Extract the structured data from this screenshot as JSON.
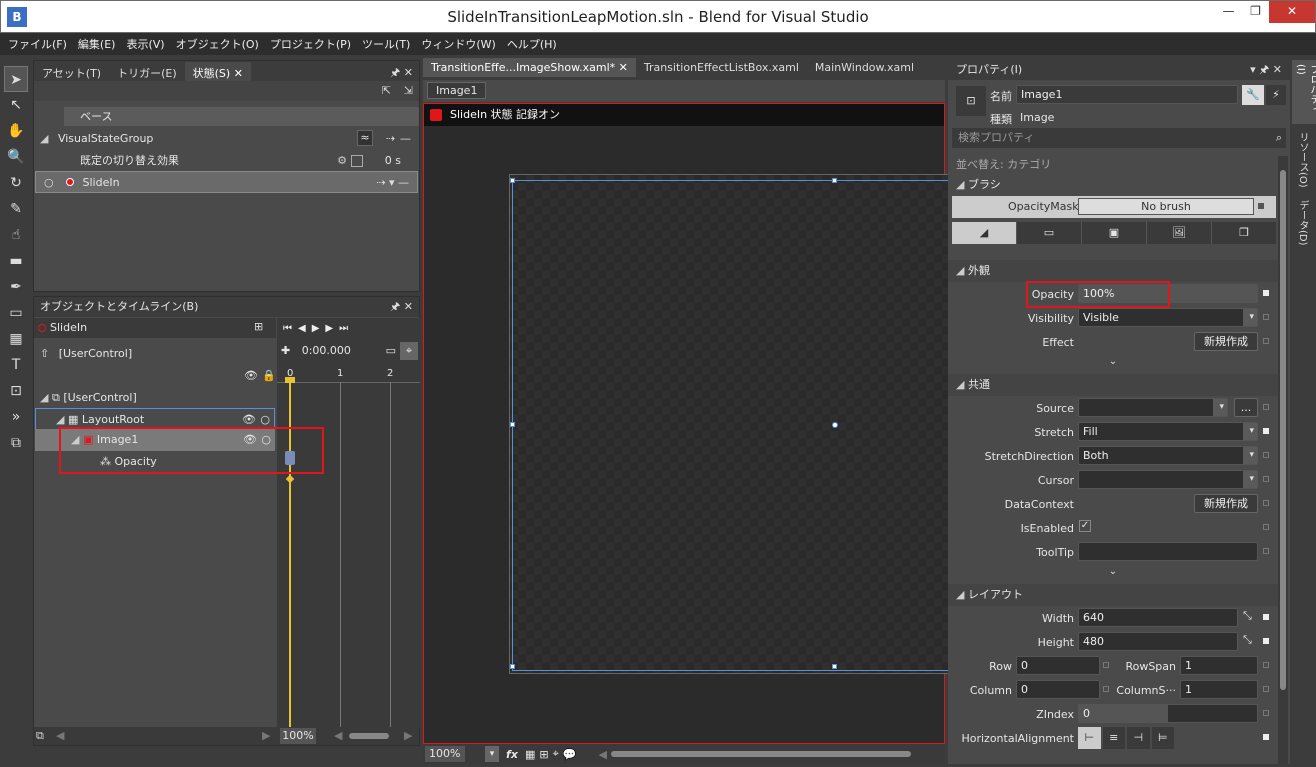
{
  "window": {
    "title": "SlideInTransitionLeapMotion.sln - Blend for Visual Studio",
    "app_icon": "B"
  },
  "menu": [
    "ファイル(F)",
    "編集(E)",
    "表示(V)",
    "オブジェクト(O)",
    "プロジェクト(P)",
    "ツール(T)",
    "ウィンドウ(W)",
    "ヘルプ(H)"
  ],
  "states_panel": {
    "tabs": [
      "アセット(T)",
      "トリガー(E)",
      "状態(S)"
    ],
    "base_label": "ベース",
    "group_name": "VisualStateGroup",
    "default_transition_label": "既定の切り替え効果",
    "default_transition_value": "0 s",
    "state_name": "SlideIn"
  },
  "timeline_panel": {
    "title": "オブジェクトとタイムライン(B)",
    "state_name": "SlideIn",
    "root_scope": "[UserControl]",
    "time": "0:00.000",
    "ruler": [
      "0",
      "1",
      "2"
    ],
    "tree": [
      {
        "name": "[UserControl]"
      },
      {
        "name": "LayoutRoot"
      },
      {
        "name": "Image1"
      },
      {
        "name": "Opacity"
      }
    ],
    "zoom": "100%"
  },
  "editor": {
    "tabs": [
      "TransitionEffe...ImageShow.xaml*",
      "TransitionEffectListBox.xaml",
      "MainWindow.xaml"
    ],
    "breadcrumb": "Image1",
    "recording_banner": "SlideIn 状態 記録オン",
    "zoom": "100%",
    "fx_label": "fx"
  },
  "properties": {
    "title": "プロパティ(I)",
    "name_label": "名前",
    "name_value": "Image1",
    "type_label": "種類",
    "type_value": "Image",
    "search_placeholder": "検索プロパティ",
    "sort_label": "並べ替え: カテゴリ",
    "side_tabs": [
      "プロパティ(I)",
      "リソース(O)",
      "データ(D)"
    ],
    "brush": {
      "header": "ブラシ",
      "mask_label": "OpacityMask",
      "mask_value": "No brush"
    },
    "appearance": {
      "header": "外観",
      "opacity_label": "Opacity",
      "opacity_value": "100%",
      "visibility_label": "Visibility",
      "visibility_value": "Visible",
      "effect_label": "Effect",
      "effect_button": "新規作成"
    },
    "common": {
      "header": "共通",
      "source_label": "Source",
      "source_value": "",
      "source_button": "...",
      "stretch_label": "Stretch",
      "stretch_value": "Fill",
      "stretchdir_label": "StretchDirection",
      "stretchdir_value": "Both",
      "cursor_label": "Cursor",
      "cursor_value": "",
      "datacontext_label": "DataContext",
      "datacontext_button": "新規作成",
      "isenabled_label": "IsEnabled",
      "isenabled_check": "✓",
      "tooltip_label": "ToolTip",
      "tooltip_value": ""
    },
    "layout": {
      "header": "レイアウト",
      "width_label": "Width",
      "width_value": "640",
      "height_label": "Height",
      "height_value": "480",
      "row_label": "Row",
      "row_value": "0",
      "rowspan_label": "RowSpan",
      "rowspan_value": "1",
      "column_label": "Column",
      "column_value": "0",
      "columnspan_label": "ColumnS···",
      "columnspan_value": "1",
      "zindex_label": "ZIndex",
      "zindex_value": "0",
      "halign_label": "HorizontalAlignment"
    }
  },
  "colors": {
    "accent_red": "#e0161b",
    "selection_blue": "#5b8fd8",
    "timeline_yellow": "#e8c230",
    "dark_bg": "#2b2b2b"
  }
}
